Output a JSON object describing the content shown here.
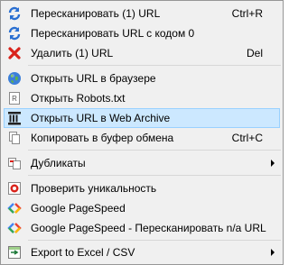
{
  "menu": {
    "items": [
      {
        "label": "Пересканировать (1) URL",
        "shortcut": "Ctrl+R",
        "icon": "rescan-icon"
      },
      {
        "label": "Пересканировать URL с кодом 0",
        "icon": "rescan-code0-icon"
      },
      {
        "label": "Удалить (1) URL",
        "shortcut": "Del",
        "icon": "delete-icon"
      },
      {
        "label": "Открыть URL в браузере",
        "icon": "globe-icon"
      },
      {
        "label": "Открыть Robots.txt",
        "icon": "robots-txt-icon"
      },
      {
        "label": "Открыть URL в Web Archive",
        "icon": "web-archive-icon",
        "highlighted": true
      },
      {
        "label": "Копировать в буфер обмена",
        "shortcut": "Ctrl+C",
        "icon": "copy-icon"
      },
      {
        "label": "Дубликаты",
        "submenu": true,
        "icon": "duplicates-icon"
      },
      {
        "label": "Проверить уникальность",
        "icon": "uniqueness-icon"
      },
      {
        "label": "Google PageSpeed",
        "icon": "pagespeed-icon"
      },
      {
        "label": "Google PageSpeed - Пересканировать n/a URL",
        "icon": "pagespeed-rescan-icon"
      },
      {
        "label": "Export to Excel / CSV",
        "submenu": true,
        "icon": "export-excel-icon"
      }
    ]
  },
  "colors": {
    "menu_bg": "#f0f0f0",
    "highlight_bg": "#cce8ff",
    "highlight_border": "#99d1ff",
    "separator": "#d7d7d7"
  }
}
